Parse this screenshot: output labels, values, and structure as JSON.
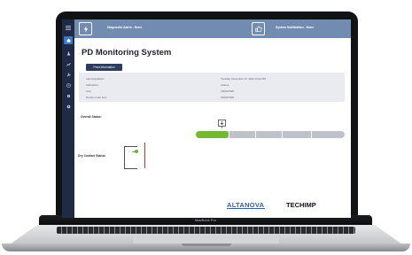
{
  "device": {
    "model_label": "MacBook Pro"
  },
  "header": {
    "diagnostic_alarm": "Diagnostic Alarm - None",
    "system_notification": "System Notification - None"
  },
  "sidebar": {
    "items": [
      {
        "icon": "menu-icon"
      },
      {
        "icon": "home-icon",
        "active": true
      },
      {
        "icon": "flask-icon"
      },
      {
        "icon": "chart-icon"
      },
      {
        "icon": "wrench-icon"
      },
      {
        "icon": "clock-icon"
      },
      {
        "icon": "gear-icon"
      },
      {
        "icon": "settings-icon"
      }
    ]
  },
  "main": {
    "title": "PD Monitoring System",
    "tab_label": "Point Information",
    "info": [
      {
        "label": "Last Acquisition:",
        "value": "Tuesday, December 13, 2022 10:02 PM"
      },
      {
        "label": "Substation:",
        "value": "ucleme"
      },
      {
        "label": "Line:",
        "value": "UNKNOWN"
      },
      {
        "label": "Device under test:",
        "value": "UNKNOWN"
      }
    ],
    "overall_status_label": "Overall Status:",
    "overall_status_progress": 0.22,
    "dry_contact_label": "Dry Contact Status:"
  },
  "footer": {
    "logo_left": "ALTANOVA",
    "logo_right": "TECHIMP"
  },
  "colors": {
    "header": "#728bb1",
    "sidebar": "#1f2a44",
    "accent_green": "#74b830",
    "button": "#2c3c5c",
    "brand_blue": "#2f5fae"
  }
}
